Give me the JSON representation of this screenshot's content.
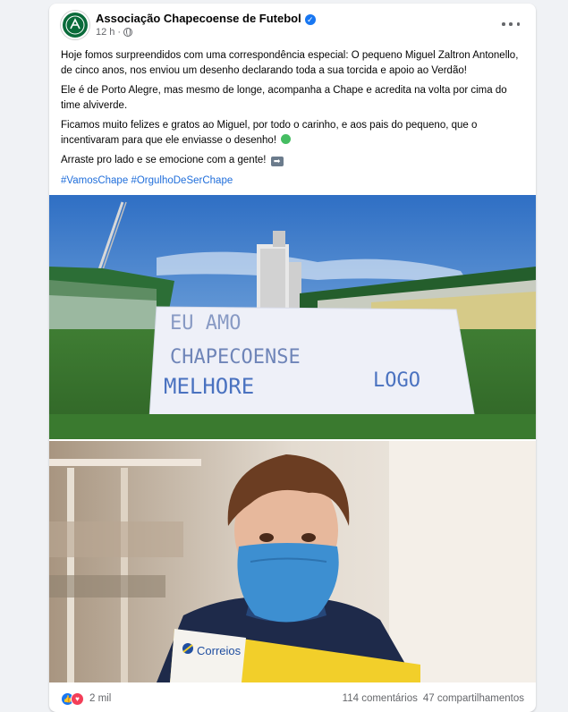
{
  "post": {
    "page_name": "Associação Chapecoense de Futebol",
    "time": "12 h",
    "paragraphs": [
      "Hoje fomos surpreendidos com uma correspondência especial: O pequeno Miguel Zaltron Antonello, de cinco anos, nos enviou um desenho declarando toda a sua torcida e apoio ao Verdão!",
      "Ele é de Porto Alegre, mas mesmo de longe, acompanha a Chape e acredita na volta por cima do time alviverde.",
      "Ficamos muito felizes e gratos ao Miguel, por todo o carinho, e aos pais do pequeno, que o incentivaram para que ele enviasse o desenho!",
      "Arraste pro lado e se emocione com a gente!"
    ],
    "hashtags": [
      "#VamosChape",
      "#OrgulhoDeSerChape"
    ],
    "icons": {
      "verified": "verified-badge-icon",
      "audience": "globe-icon",
      "more": "more-options-icon",
      "heart": "green-heart-emoji",
      "arrow": "right-arrow-emoji"
    }
  },
  "photo1": {
    "paper_lines": [
      "EU AMO",
      "CHAPECOENSE",
      "MELHORE",
      "LOGO"
    ]
  },
  "photo2": {
    "envelope_text": "Correios"
  },
  "footer": {
    "reaction_count": "2 mil",
    "comments": "114 comentários",
    "shares": "47 compartilhamentos"
  },
  "colors": {
    "brand_green": "#0a6b3a",
    "link_blue": "#216fdb",
    "like_blue": "#1877f2",
    "love_red": "#f33e58",
    "mask_blue": "#3d8fd1"
  }
}
